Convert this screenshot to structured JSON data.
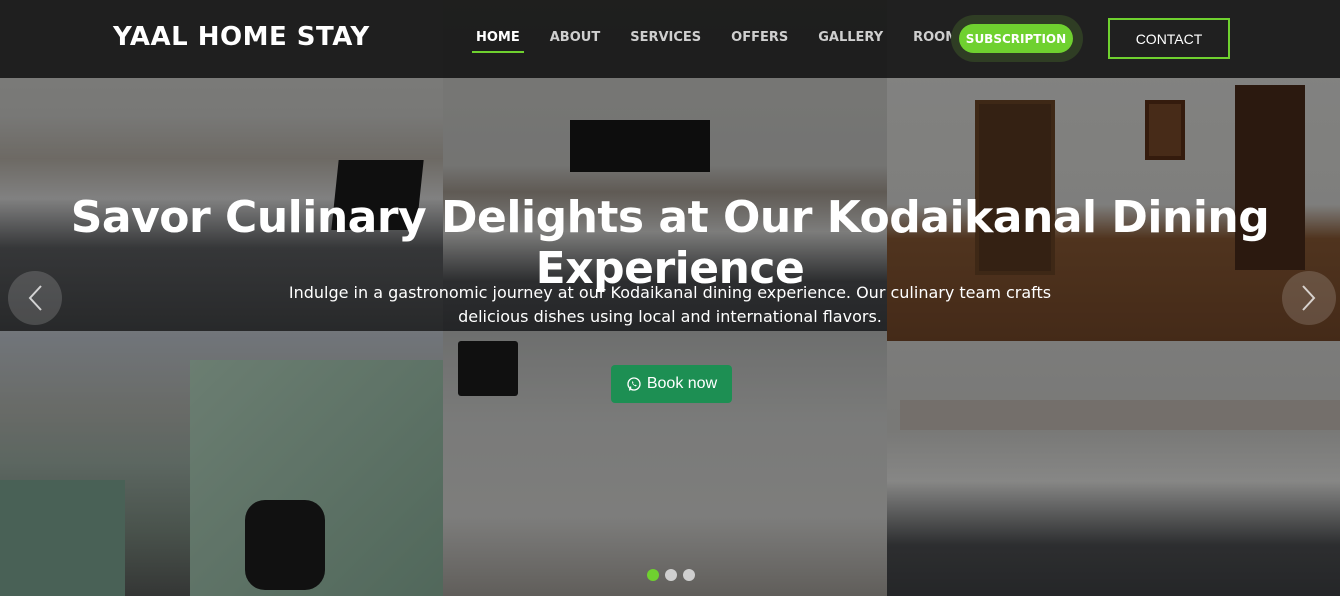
{
  "navbar": {
    "brand": "YAAL HOME STAY",
    "links": [
      {
        "label": "HOME",
        "active": true
      },
      {
        "label": "ABOUT",
        "active": false
      },
      {
        "label": "SERVICES",
        "active": false
      },
      {
        "label": "OFFERS",
        "active": false
      },
      {
        "label": "GALLERY",
        "active": false
      },
      {
        "label": "ROOMS",
        "active": false
      }
    ],
    "subscription_label": "SUBSCRIPTION",
    "contact_label": "CONTACT"
  },
  "hero": {
    "headline": "Savor Culinary Delights at Our Kodaikanal Dining Experience",
    "subtext": "Indulge in a gastronomic journey at our Kodaikanal dining experience. Our culinary team crafts delicious dishes using local and international flavors.",
    "cta_label": "Book now",
    "cta_icon": "whatsapp-icon",
    "prev_icon": "chevron-left-icon",
    "next_icon": "chevron-right-icon",
    "slides_count": 3,
    "active_slide": 1
  },
  "colors": {
    "accent": "#6fd12f",
    "cta_bg": "#1d8f53",
    "navbar_bg": "#121212"
  }
}
